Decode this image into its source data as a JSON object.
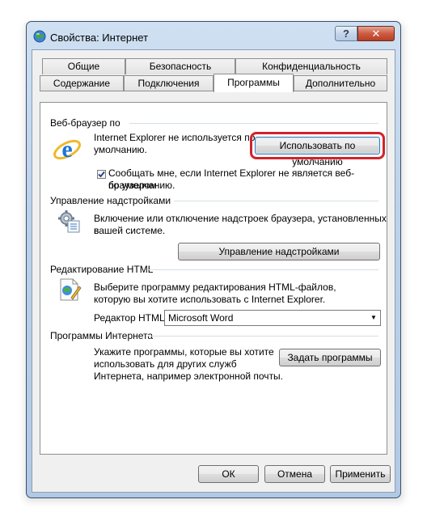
{
  "window": {
    "title": "Свойства: Интернет",
    "help_btn": "?",
    "close_btn": "✕"
  },
  "tabs_row1": [
    "Общие",
    "Безопасность",
    "Конфиденциальность"
  ],
  "tabs_row2": [
    "Содержание",
    "Подключения",
    "Программы",
    "Дополнительно"
  ],
  "active_tab": "Программы",
  "browser": {
    "group": "Веб-браузер по",
    "text_line1": "Internet Explorer не используется по",
    "text_line2": "умолчанию.",
    "default_btn": "Использовать по умолчанию",
    "checkbox_checked": true,
    "checkbox_line1": "Сообщать мне, если Internet Explorer не является веб-браузером",
    "checkbox_line2": "по умолчанию."
  },
  "addons": {
    "group": "Управление надстройками",
    "text_line1": "Включение или отключение надстроек браузера, установленных в",
    "text_line2": "вашей системе.",
    "btn": "Управление надстройками"
  },
  "html_edit": {
    "group": "Редактирование HTML",
    "text_line1": "Выберите программу редактирования HTML-файлов,",
    "text_line2": "которую вы хотите использовать с Internet Explorer.",
    "editor_label": "Редактор HTML:",
    "editor_value": "Microsoft Word"
  },
  "internet_programs": {
    "group": "Программы Интернета",
    "text_line1": "Укажите программы, которые вы хотите",
    "text_line2": "использовать для других служб",
    "text_line3": "Интернета, например электронной почты.",
    "btn": "Задать программы"
  },
  "footer": {
    "ok": "ОК",
    "cancel": "Отмена",
    "apply": "Применить"
  },
  "colors": {
    "highlight": "#d2232a",
    "ie_blue": "#1e73d8",
    "ie_ring": "#f0b92a"
  }
}
